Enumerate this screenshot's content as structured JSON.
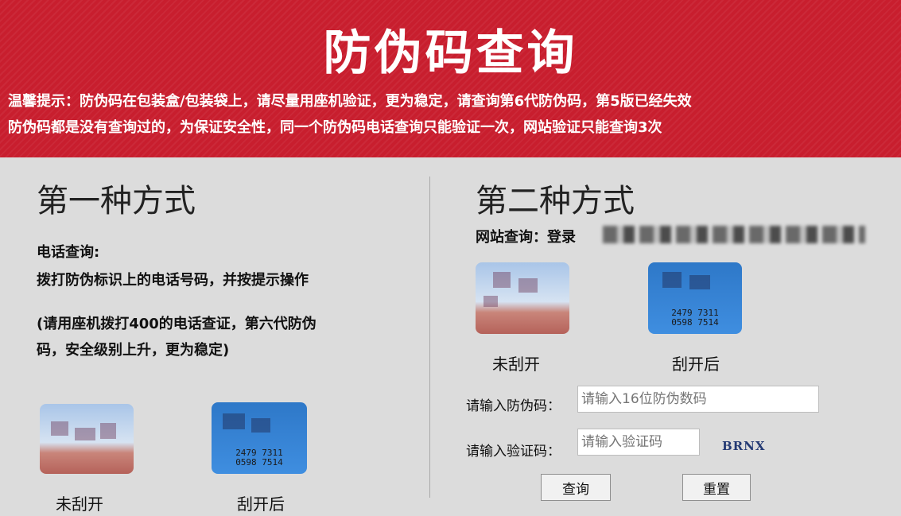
{
  "banner": {
    "title": "防伪码查询",
    "tip_line1": "温馨提示：防伪码在包装盒/包装袋上，请尽量用座机验证，更为稳定，请查询第6代防伪码，第5版已经失效",
    "tip_line2": "防伪码都是没有查询过的，为保证安全性，同一个防伪码电话查询只能验证一次，网站验证只能查询3次"
  },
  "method1": {
    "title": "第一种方式",
    "label": "电话查询:",
    "desc": "拨打防伪标识上的电话号码，并按提示操作",
    "note_line1": "(请用座机拨打400的电话查证，第六代防伪",
    "note_line2": "码，安全级别上升，更为稳定)",
    "caption_unscratched": "未刮开",
    "caption_scratched": "刮开后",
    "code_line1": "2479 7311",
    "code_line2": "0598 7514"
  },
  "method2": {
    "title": "第二种方式",
    "web_label": "网站查询：登录",
    "caption_unscratched": "未刮开",
    "caption_scratched": "刮开后",
    "code_line1": "2479 7311",
    "code_line2": "0598 7514",
    "form": {
      "code_label": "请输入防伪码：",
      "code_placeholder": "请输入16位防伪数码",
      "verify_label": "请输入验证码：",
      "verify_placeholder": "请输入验证码",
      "captcha": "BRNX",
      "query_button": "查询",
      "reset_button": "重置"
    }
  }
}
